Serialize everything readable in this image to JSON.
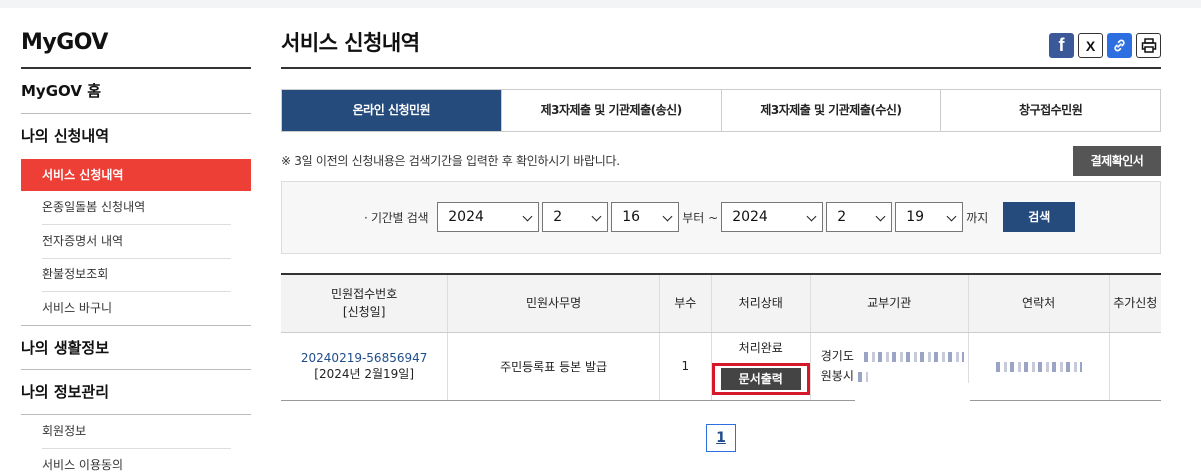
{
  "sidebar": {
    "logo": "MyGOV",
    "home": "MyGOV 홈",
    "sections": [
      {
        "title": "나의 신청내역",
        "items": [
          "서비스 신청내역",
          "온종일돌봄 신청내역",
          "전자증명서 내역",
          "환불정보조회",
          "서비스 바구니"
        ]
      },
      {
        "title": "나의 생활정보"
      },
      {
        "title": "나의 정보관리",
        "items": [
          "회원정보",
          "서비스 이용동의"
        ]
      }
    ]
  },
  "header": {
    "title": "서비스 신청내역",
    "share": {
      "facebook": "f",
      "x": "X",
      "link": "🔗",
      "print": "⎙"
    }
  },
  "tabs": [
    "온라인 신청민원",
    "제3자제출 및 기관제출(송신)",
    "제3자제출 및 기관제출(수신)",
    "창구접수민원"
  ],
  "notice": "※ 3일 이전의 신청내용은 검색기간을 입력한 후 확인하시기 바랍니다.",
  "confirm_button": "결제확인서",
  "search": {
    "label": "· 기간별 검색",
    "from": {
      "year": "2024",
      "month": "2",
      "day": "16"
    },
    "from_suffix": "부터 ~",
    "to": {
      "year": "2024",
      "month": "2",
      "day": "19"
    },
    "to_suffix": "까지",
    "button": "검색"
  },
  "table": {
    "headers": [
      "민원접수번호\n[신청일]",
      "민원사무명",
      "부수",
      "처리상태",
      "교부기관",
      "연락처",
      "추가신청"
    ],
    "header_line1": "민원접수번호",
    "header_line2": "[신청일]",
    "rows": [
      {
        "app_no": "20240219-56856947",
        "app_date": "[2024년 2월19일]",
        "service": "주민등록표 등본 발급",
        "copies": "1",
        "status": "처리완료",
        "doc_button": "문서출력",
        "agency_line1": "경기도",
        "agency_line2": "원봉시"
      }
    ]
  },
  "pagination": {
    "current": "1"
  },
  "colors": {
    "accent": "#ee3f36",
    "primary": "#254b7c",
    "highlight": "#d5192a"
  }
}
